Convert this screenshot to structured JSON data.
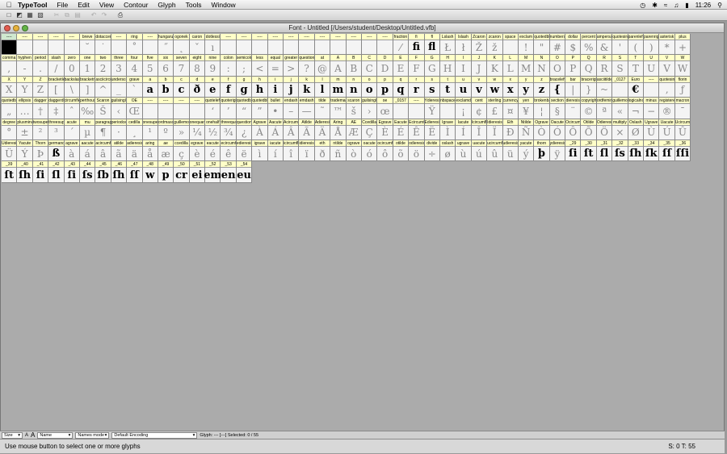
{
  "menubar": {
    "app": "TypeTool",
    "items": [
      "File",
      "Edit",
      "View",
      "Contour",
      "Glyph",
      "Tools",
      "Window"
    ],
    "clock": "11:26"
  },
  "window": {
    "title": "Font - Untitled [/Users/student/Desktop/Untitled.vfb]"
  },
  "grid": [
    {
      "l": [
        "----",
        "----",
        "----",
        "----",
        "----",
        "breve",
        "dotaccent",
        "----",
        "ring",
        "----",
        "hungarumlaut",
        "ogonek",
        "caron",
        "dotlessi",
        "----",
        "----",
        "----",
        "----",
        "----",
        "----",
        "----",
        "----",
        "----",
        "----",
        "----",
        "fraction",
        "fi",
        "fl",
        "Lslash",
        "lslash",
        "Zcaron",
        "zcaron",
        "space",
        "exclam",
        "quotedbl",
        "numbersign",
        "dollar",
        "percent",
        "ampersand",
        "quotesingle",
        "parenleft",
        "parenright",
        "asterisk",
        "plus"
      ],
      "g": [
        "",
        "",
        "",
        "",
        "",
        "˘",
        "˙",
        "",
        "˚",
        "",
        "˝",
        "˛",
        "ˇ",
        "ı",
        "",
        "",
        "",
        "",
        "",
        "",
        "",
        "",
        "",
        "",
        "",
        "⁄",
        "ﬁ",
        "ﬂ",
        "Ł",
        "ł",
        "Ž",
        "ž",
        "",
        "!",
        "\"",
        "#",
        "$",
        "%",
        "&",
        "'",
        "(",
        ")",
        "*",
        "+"
      ],
      "p": [
        26,
        27
      ],
      "sel": [
        0
      ]
    },
    {
      "l": [
        "comma",
        "hyphen",
        "period",
        "slash",
        "zero",
        "one",
        "two",
        "three",
        "four",
        "five",
        "six",
        "seven",
        "eight",
        "nine",
        "colon",
        "semicolon",
        "less",
        "equal",
        "greater",
        "question",
        "at",
        "A",
        "B",
        "C",
        "D",
        "E",
        "F",
        "G",
        "H",
        "I",
        "J",
        "K",
        "L",
        "M",
        "N",
        "O",
        "P",
        "Q",
        "R",
        "S",
        "T",
        "U",
        "V",
        "W"
      ],
      "g": [
        ",",
        "-",
        ".",
        "/",
        "0",
        "1",
        "2",
        "3",
        "4",
        "5",
        "6",
        "7",
        "8",
        "9",
        ":",
        ";",
        "<",
        "=",
        ">",
        "?",
        "@",
        "A",
        "B",
        "C",
        "D",
        "E",
        "F",
        "G",
        "H",
        "I",
        "J",
        "K",
        "L",
        "M",
        "N",
        "O",
        "P",
        "Q",
        "R",
        "S",
        "T",
        "U",
        "V",
        "W"
      ],
      "p": [],
      "sel": []
    },
    {
      "l": [
        "X",
        "Y",
        "Z",
        "bracketleft",
        "backslash",
        "bracketright",
        "asciicircum",
        "underscore",
        "grave",
        "a",
        "b",
        "c",
        "d",
        "e",
        "f",
        "g",
        "h",
        "i",
        "j",
        "k",
        "l",
        "m",
        "n",
        "o",
        "p",
        "q",
        "r",
        "s",
        "t",
        "u",
        "v",
        "w",
        "x",
        "y",
        "z",
        "braceleft",
        "bar",
        "braceright",
        "asciitilde",
        "_0127",
        "Euro",
        "----",
        "quotesinglbase",
        "florin"
      ],
      "g": [
        "X",
        "Y",
        "Z",
        "[",
        "\\",
        "]",
        "^",
        "_",
        "`",
        "a",
        "b",
        "c",
        "ð",
        "e",
        "f",
        "g",
        "h",
        "i",
        "j",
        "k",
        "l",
        "m",
        "n",
        "o",
        "p",
        "q",
        "r",
        "s",
        "t",
        "u",
        "v",
        "w",
        "x",
        "y",
        "z",
        "{",
        "|",
        "}",
        "~",
        "",
        "€",
        "",
        "‚",
        "ƒ"
      ],
      "p": [
        9,
        10,
        11,
        12,
        13,
        14,
        15,
        16,
        17,
        18,
        19,
        20,
        21,
        22,
        23,
        24,
        25,
        26,
        27,
        28,
        29,
        30,
        31,
        32,
        33,
        34,
        35,
        40
      ],
      "sel": []
    },
    {
      "l": [
        "quotedblbase",
        "ellipsis",
        "dagger",
        "daggerdbl",
        "circumflex",
        "perthousand",
        "Scaron",
        "guilsinglleft",
        "OE",
        "----",
        "----",
        "----",
        "----",
        "quoteleft",
        "quoteright",
        "quotedblleft",
        "quotedblright",
        "bullet",
        "endash",
        "emdash",
        "tilde",
        "trademark",
        "scaron",
        "guilsinglright",
        "oe",
        "_0157",
        "----",
        "Ydieresis",
        "nbspace",
        "exclamdown",
        "cent",
        "sterling",
        "currency",
        "yen",
        "brokenbar",
        "section",
        "dieresis",
        "copyright",
        "ordfeminine",
        "guillemotleft",
        "logicalnot",
        "minus",
        "registered",
        "macron"
      ],
      "g": [
        "„",
        "…",
        "†",
        "‡",
        "ˆ",
        "‰",
        "Š",
        "‹",
        "Œ",
        "",
        "",
        "",
        "",
        "‘",
        "’",
        "“",
        "”",
        "•",
        "–",
        "—",
        "˜",
        "™",
        "š",
        "›",
        "œ",
        "",
        "",
        "Ÿ",
        "",
        "¡",
        "¢",
        "£",
        "¤",
        "¥",
        "¦",
        "§",
        "¨",
        "©",
        "ª",
        "«",
        "¬",
        "−",
        "®",
        "¯"
      ],
      "p": [
        25
      ],
      "sel": []
    },
    {
      "l": [
        "degree",
        "plusminus",
        "twosuperior",
        "threesuperior",
        "acute",
        "mu",
        "paragraph",
        "periodcentered",
        "cedilla",
        "onesuperior",
        "ordmasculine",
        "guillemotright",
        "onequarter",
        "onehalf",
        "threequarters",
        "questiondown",
        "Agrave",
        "Aacute",
        "Acircumflex",
        "Atilde",
        "Adieresis",
        "Aring",
        "AE",
        "Ccedilla",
        "Egrave",
        "Eacute",
        "Ecircumflex",
        "Edieresis",
        "Igrave",
        "Iacute",
        "Icircumflex",
        "Idieresis",
        "Eth",
        "Ntilde",
        "Ograve",
        "Oacute",
        "Ocircumflex",
        "Otilde",
        "Odieresis",
        "multiply",
        "Oslash",
        "Ugrave",
        "Uacute",
        "Ucircumflex"
      ],
      "g": [
        "°",
        "±",
        "²",
        "³",
        "´",
        "µ",
        "¶",
        "·",
        "¸",
        "¹",
        "º",
        "»",
        "¼",
        "½",
        "¾",
        "¿",
        "À",
        "Á",
        "Â",
        "Ã",
        "Ä",
        "Å",
        "Æ",
        "Ç",
        "È",
        "É",
        "Ê",
        "Ë",
        "Ì",
        "Í",
        "Î",
        "Ï",
        "Ð",
        "Ñ",
        "Ò",
        "Ó",
        "Ô",
        "Õ",
        "Ö",
        "×",
        "Ø",
        "Ù",
        "Ú",
        "Û"
      ],
      "p": [],
      "sel": []
    },
    {
      "l": [
        "Udieresis",
        "Yacute",
        "Thorn",
        "germandbls",
        "agrave",
        "aacute",
        "acircumflex",
        "atilde",
        "adieresis",
        "aring",
        "ae",
        "ccedilla",
        "egrave",
        "eacute",
        "ecircumflex",
        "edieresis",
        "igrave",
        "iacute",
        "icircumflex",
        "idieresis",
        "eth",
        "ntilde",
        "ograve",
        "oacute",
        "ocircumflex",
        "otilde",
        "odieresis",
        "divide",
        "oslash",
        "ugrave",
        "uacute",
        "ucircumflex",
        "udieresis",
        "yacute",
        "thorn",
        "ydieresis",
        "_29",
        "_30",
        "_31",
        "_32",
        "_33",
        "_34",
        "_35",
        "_36"
      ],
      "g": [
        "Ü",
        "Ý",
        "Þ",
        "ß",
        "à",
        "á",
        "â",
        "ã",
        "ä",
        "å",
        "æ",
        "ç",
        "è",
        "é",
        "ê",
        "ë",
        "ì",
        "í",
        "î",
        "ï",
        "ð",
        "ñ",
        "ò",
        "ó",
        "ô",
        "õ",
        "ö",
        "÷",
        "ø",
        "ù",
        "ú",
        "û",
        "ü",
        "ý",
        "þ",
        "ÿ",
        "ſi",
        "ſt",
        "ſl",
        "ſs",
        "ſh",
        "ſk",
        "ſſ",
        "ſſi"
      ],
      "p": [
        3,
        34,
        36,
        37,
        38,
        39,
        40,
        41,
        42,
        43
      ],
      "sel": []
    },
    {
      "l": [
        "_39",
        "_40",
        "_41",
        "_42",
        "_43",
        "_44",
        "_45",
        "_46",
        "_47",
        "_48",
        "_49",
        "_50",
        "_51",
        "_52",
        "_53",
        "_54"
      ],
      "g": [
        "ſt",
        "ſh",
        "ſi",
        "ſl",
        "ſi",
        "ſs",
        "ſb",
        "ſh",
        "ſſ",
        "w",
        "p",
        "cr",
        "ei",
        "em",
        "en",
        "eu"
      ],
      "p": [
        0,
        1,
        2,
        3,
        4,
        5,
        6,
        7,
        8,
        9,
        10,
        11,
        12,
        13,
        14,
        15
      ],
      "sel": []
    }
  ],
  "controls": {
    "size": "Size",
    "name_mode": "Name",
    "names_mode": "Names mode",
    "encoding": "Default Encoding",
    "glyph_info": "Glyph: --- [---]  Selected: 0 / 55"
  },
  "status": {
    "left": "Use mouse button to select one or more glyphs",
    "right": "S: 0 T: 55"
  }
}
